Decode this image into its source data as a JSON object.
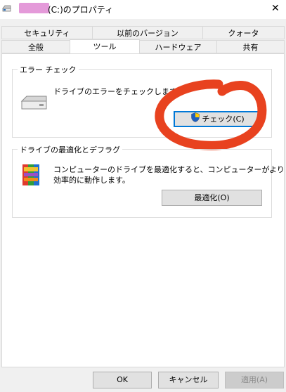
{
  "window": {
    "title_suffix": "(C:)のプロパティ",
    "close_glyph": "✕"
  },
  "tabs": {
    "row1": [
      "セキュリティ",
      "以前のバージョン",
      "クォータ"
    ],
    "row2": [
      "全般",
      "ツール",
      "ハードウェア",
      "共有"
    ],
    "active": "ツール"
  },
  "error_check": {
    "group_label": "エラー チェック",
    "description": "ドライブのエラーをチェックします。",
    "button_label": "チェック(C)"
  },
  "optimize": {
    "group_label": "ドライブの最適化とデフラグ",
    "description_line1": "コンピューターのドライブを最適化すると、コンピューターがより",
    "description_line2": "効率的に動作します。",
    "button_label": "最適化(O)"
  },
  "footer": {
    "ok_label": "OK",
    "cancel_label": "キャンセル",
    "apply_label": "適用(A)"
  },
  "colors": {
    "annotation_circle": "#e8421f",
    "redaction": "#e49ad9",
    "focus_border": "#0078d7"
  }
}
